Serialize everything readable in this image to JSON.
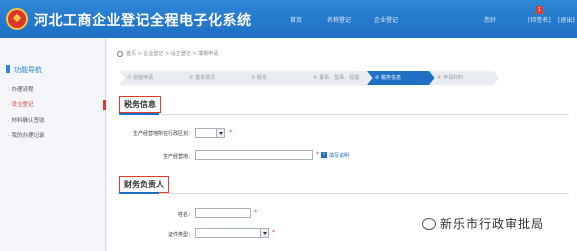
{
  "header": {
    "title": "河北工商企业登记全程电子化系统",
    "nav": [
      "首页",
      "名称登记",
      "企业登记"
    ],
    "user_greeting": "您好",
    "badge_count": "1",
    "logout_label": "[待签名]",
    "exit_label": "[退出]"
  },
  "sidebar": {
    "title": "功能导航",
    "items": [
      {
        "label": "· 办理流程"
      },
      {
        "label": "· 设立登记"
      },
      {
        "label": "· 材料确认签收"
      },
      {
        "label": "· 我的办理记录"
      }
    ]
  },
  "breadcrumb": "首页 > 企业登记 > 设立登记 > 填报申请",
  "steps": [
    {
      "label": "① 创建申请"
    },
    {
      "label": "② 基本情况"
    },
    {
      "label": "③ 股东"
    },
    {
      "label": "④ 董事、监事、经理"
    },
    {
      "label": "⑤ 税务信息"
    },
    {
      "label": "⑥ 申请材料"
    }
  ],
  "sections": {
    "tax": {
      "title": "税务信息",
      "region_label": "生产经营地所在行政区划：",
      "region_value": "",
      "address_label": "生产经营地：",
      "address_value": "",
      "help_icon": "?",
      "help_link": "填写说明"
    },
    "finance": {
      "title": "财务负责人",
      "name_label": "姓名：",
      "name_value": "",
      "id_type_label": "证件类型：",
      "id_type_value": ""
    }
  },
  "watermark": {
    "text": "新乐市行政审批局"
  },
  "colors": {
    "header_blue": "#1f6fc4",
    "accent_red": "#e23b2e"
  }
}
